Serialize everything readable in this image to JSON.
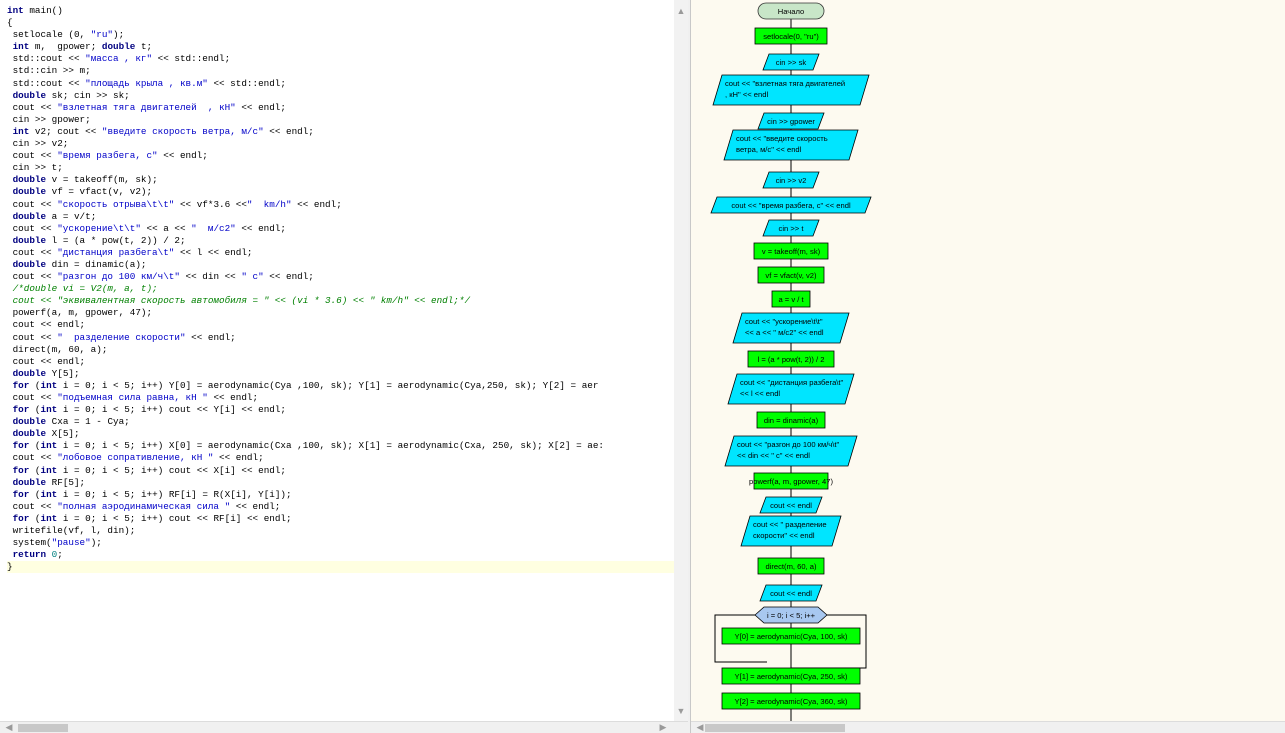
{
  "editor": {
    "lines": [
      [
        [
          "kw",
          "int"
        ],
        [
          "t",
          " main()"
        ]
      ],
      [
        [
          "t",
          "{"
        ]
      ],
      [
        [
          "t",
          " setlocale (0, "
        ],
        [
          "str",
          "\"ru\""
        ],
        [
          "t",
          ");"
        ]
      ],
      [
        [
          "t",
          " "
        ],
        [
          "kw",
          "int"
        ],
        [
          "t",
          " m,  gpower; "
        ],
        [
          "kw",
          "double"
        ],
        [
          "t",
          " t;"
        ]
      ],
      [
        [
          "t",
          " std::cout << "
        ],
        [
          "str",
          "\"масса , кг\""
        ],
        [
          "t",
          " << std::endl;"
        ]
      ],
      [
        [
          "t",
          " std::cin >> m;"
        ]
      ],
      [
        [
          "t",
          " std::cout << "
        ],
        [
          "str",
          "\"площадь крыла , кв.м\""
        ],
        [
          "t",
          " << std::endl;"
        ]
      ],
      [
        [
          "t",
          " "
        ],
        [
          "kw",
          "double"
        ],
        [
          "t",
          " sk; cin >> sk;"
        ]
      ],
      [
        [
          "t",
          " cout << "
        ],
        [
          "str",
          "\"взлетная тяга двигателей  , кН\""
        ],
        [
          "t",
          " << endl;"
        ]
      ],
      [
        [
          "t",
          " cin >> gpower;"
        ]
      ],
      [
        [
          "t",
          " "
        ],
        [
          "kw",
          "int"
        ],
        [
          "t",
          " v2; cout << "
        ],
        [
          "str",
          "\"введите скорость ветра, м/с\""
        ],
        [
          "t",
          " << endl;"
        ]
      ],
      [
        [
          "t",
          " cin >> v2;"
        ]
      ],
      [
        [
          "t",
          " cout << "
        ],
        [
          "str",
          "\"время разбега, с\""
        ],
        [
          "t",
          " << endl;"
        ]
      ],
      [
        [
          "t",
          " cin >> t;"
        ]
      ],
      [
        [
          "t",
          " "
        ],
        [
          "kw",
          "double"
        ],
        [
          "t",
          " v = takeoff(m, sk);"
        ]
      ],
      [
        [
          "t",
          " "
        ],
        [
          "kw",
          "double"
        ],
        [
          "t",
          " vf = vfact(v, v2);"
        ]
      ],
      [
        [
          "t",
          " cout << "
        ],
        [
          "str",
          "\"скорость отрыва\\t\\t\""
        ],
        [
          "t",
          " << vf*3.6 <<"
        ],
        [
          "str",
          "\"  km/h\""
        ],
        [
          "t",
          " << endl;"
        ]
      ],
      [
        [
          "t",
          " "
        ],
        [
          "kw",
          "double"
        ],
        [
          "t",
          " a = v/t;"
        ]
      ],
      [
        [
          "t",
          " cout << "
        ],
        [
          "str",
          "\"ускорение\\t\\t\""
        ],
        [
          "t",
          " << a << "
        ],
        [
          "str",
          "\"  м/с2\""
        ],
        [
          "t",
          " << endl;"
        ]
      ],
      [
        [
          "t",
          " "
        ],
        [
          "kw",
          "double"
        ],
        [
          "t",
          " l = (a * pow(t, 2)) / 2;"
        ]
      ],
      [
        [
          "t",
          " cout << "
        ],
        [
          "str",
          "\"дистанция разбега\\t\""
        ],
        [
          "t",
          " << l << endl;"
        ]
      ],
      [
        [
          "t",
          " "
        ],
        [
          "kw",
          "double"
        ],
        [
          "t",
          " din = dinamic(a);"
        ]
      ],
      [
        [
          "t",
          " cout << "
        ],
        [
          "str",
          "\"разгон до 100 км/ч\\t\""
        ],
        [
          "t",
          " << din << "
        ],
        [
          "str",
          "\" с\""
        ],
        [
          "t",
          " << endl;"
        ]
      ],
      [
        [
          "cmt",
          " /*double vi = V2(m, a, t);"
        ]
      ],
      [
        [
          "cmt",
          " cout << \"эквивалентная скорость автомобиля = \" << (vi * 3.6) << \" km/h\" << endl;*/"
        ]
      ],
      [
        [
          "t",
          " powerf(a, m, gpower, 47);"
        ]
      ],
      [
        [
          "t",
          " cout << endl;"
        ]
      ],
      [
        [
          "t",
          " cout << "
        ],
        [
          "str",
          "\"  разделение скорости\""
        ],
        [
          "t",
          " << endl;"
        ]
      ],
      [
        [
          "t",
          " direct(m, 60, a);"
        ]
      ],
      [
        [
          "t",
          " cout << endl;"
        ]
      ],
      [
        [
          "t",
          " "
        ],
        [
          "kw",
          "double"
        ],
        [
          "t",
          " Y[5];"
        ]
      ],
      [
        [
          "t",
          " "
        ],
        [
          "kw",
          "for"
        ],
        [
          "t",
          " ("
        ],
        [
          "kw",
          "int"
        ],
        [
          "t",
          " i = 0; i < 5; i++) Y[0] = aerodynamic(Cya ,100, sk); Y[1] = aerodynamic(Cya,250, sk); Y[2] = aer"
        ]
      ],
      [
        [
          "t",
          " cout << "
        ],
        [
          "str",
          "\"подъемная сила равна, кН \""
        ],
        [
          "t",
          " << endl;"
        ]
      ],
      [
        [
          "t",
          " "
        ],
        [
          "kw",
          "for"
        ],
        [
          "t",
          " ("
        ],
        [
          "kw",
          "int"
        ],
        [
          "t",
          " i = 0; i < 5; i++) cout << Y[i] << endl;"
        ]
      ],
      [
        [
          "t",
          " "
        ],
        [
          "kw",
          "double"
        ],
        [
          "t",
          " Cxa = 1 - Cya;"
        ]
      ],
      [
        [
          "t",
          " "
        ],
        [
          "kw",
          "double"
        ],
        [
          "t",
          " X[5];"
        ]
      ],
      [
        [
          "t",
          " "
        ],
        [
          "kw",
          "for"
        ],
        [
          "t",
          " ("
        ],
        [
          "kw",
          "int"
        ],
        [
          "t",
          " i = 0; i < 5; i++) X[0] = aerodynamic(Cxa ,100, sk); X[1] = aerodynamic(Cxa, 250, sk); X[2] = ae:"
        ]
      ],
      [
        [
          "t",
          " cout << "
        ],
        [
          "str",
          "\"лобовое сопративление, кН \""
        ],
        [
          "t",
          " << endl;"
        ]
      ],
      [
        [
          "t",
          " "
        ],
        [
          "kw",
          "for"
        ],
        [
          "t",
          " ("
        ],
        [
          "kw",
          "int"
        ],
        [
          "t",
          " i = 0; i < 5; i++) cout << X[i] << endl;"
        ]
      ],
      [
        [
          "t",
          " "
        ],
        [
          "kw",
          "double"
        ],
        [
          "t",
          " RF[5];"
        ]
      ],
      [
        [
          "t",
          " "
        ],
        [
          "kw",
          "for"
        ],
        [
          "t",
          " ("
        ],
        [
          "kw",
          "int"
        ],
        [
          "t",
          " i = 0; i < 5; i++) RF[i] = R(X[i], Y[i]);"
        ]
      ],
      [
        [
          "t",
          " cout << "
        ],
        [
          "str",
          "\"полная аэродинамическая сила \""
        ],
        [
          "t",
          " << endl;"
        ]
      ],
      [
        [
          "t",
          " "
        ],
        [
          "kw",
          "for"
        ],
        [
          "t",
          " ("
        ],
        [
          "kw",
          "int"
        ],
        [
          "t",
          " i = 0; i < 5; i++) cout << RF[i] << endl;"
        ]
      ],
      [
        [
          "t",
          " writefile(vf, l, din);"
        ]
      ],
      [
        [
          "t",
          " system("
        ],
        [
          "str",
          "\"pause\""
        ],
        [
          "t",
          ");"
        ]
      ],
      [
        [
          "t",
          " "
        ],
        [
          "kw",
          "return"
        ],
        [
          "t",
          " "
        ],
        [
          "num",
          "0"
        ],
        [
          "t",
          ";"
        ]
      ],
      [
        [
          "t",
          "}"
        ]
      ]
    ],
    "current_line": 46,
    "colors": {
      "keyword": "#000080",
      "string": "#0000c8",
      "number": "#008080",
      "comment": "#008000",
      "current_line_bg": "#ffffe1"
    }
  },
  "flowchart": {
    "colors": {
      "terminal": "#c8e6c8",
      "process": "#00ff00",
      "io": "#00e5ff",
      "loop": "#a8c8f0",
      "background": "#fdfaf0"
    },
    "nodes": [
      {
        "type": "terminal",
        "lines": [
          "Начало"
        ]
      },
      {
        "type": "process",
        "lines": [
          "setlocale(0, \"ru\")"
        ]
      },
      {
        "type": "io",
        "lines": [
          "cin >> sk"
        ]
      },
      {
        "type": "io",
        "lines": [
          "cout << \"взлетная тяга двигателей",
          ", кН\" << endl"
        ]
      },
      {
        "type": "io",
        "lines": [
          "cin >> gpower"
        ]
      },
      {
        "type": "io",
        "lines": [
          "cout << \"введите скорость",
          "ветра, м/с\" << endl"
        ]
      },
      {
        "type": "io",
        "lines": [
          "cin >> v2"
        ]
      },
      {
        "type": "io",
        "lines": [
          "cout << \"время разбега, с\" << endl"
        ]
      },
      {
        "type": "io",
        "lines": [
          "cin >> t"
        ]
      },
      {
        "type": "process",
        "lines": [
          "v = takeoff(m, sk)"
        ]
      },
      {
        "type": "process",
        "lines": [
          "vf = vfact(v, v2)"
        ]
      },
      {
        "type": "process",
        "lines": [
          "a = v / t"
        ]
      },
      {
        "type": "io",
        "lines": [
          "cout << \"ускорение\\t\\t\"",
          "<< a << \" м/с2\" << endl"
        ]
      },
      {
        "type": "process",
        "lines": [
          "l = (a * pow(t, 2)) / 2"
        ]
      },
      {
        "type": "io",
        "lines": [
          "cout << \"дистанция разбега\\t\"",
          "<< l << endl"
        ]
      },
      {
        "type": "process",
        "lines": [
          "din = dinamic(a)"
        ]
      },
      {
        "type": "io",
        "lines": [
          "cout << \"разгон до 100 км/ч\\t\"",
          "<< din << \" с\" << endl"
        ]
      },
      {
        "type": "process",
        "lines": [
          "powerf(a, m, gpower, 47)"
        ]
      },
      {
        "type": "io",
        "lines": [
          "cout << endl"
        ]
      },
      {
        "type": "io",
        "lines": [
          "cout << \" разделение",
          "скорости\" << endl"
        ]
      },
      {
        "type": "process",
        "lines": [
          "direct(m, 60, a)"
        ]
      },
      {
        "type": "io",
        "lines": [
          "cout << endl"
        ]
      },
      {
        "type": "loop",
        "lines": [
          "i = 0; i < 5; i++"
        ]
      },
      {
        "type": "process",
        "lines": [
          "Y[0] = aerodynamic(Cya, 100, sk)"
        ]
      },
      {
        "type": "process",
        "lines": [
          "Y[1] = aerodynamic(Cya, 250, sk)"
        ]
      },
      {
        "type": "process",
        "lines": [
          "Y[2] = aerodynamic(Cya, 360, sk)"
        ]
      }
    ]
  }
}
